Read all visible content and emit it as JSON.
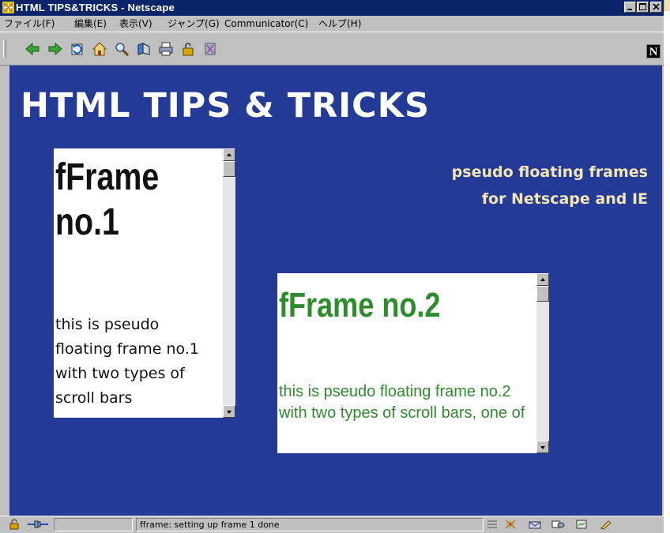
{
  "window": {
    "title": "HTML  TIPS&TRICKS - Netscape",
    "controls": [
      "minimize",
      "maximize",
      "close"
    ]
  },
  "menu": [
    {
      "label": "ファイル(F)"
    },
    {
      "label": "編集(E)"
    },
    {
      "label": "表示(V)"
    },
    {
      "label": "ジャンプ(G)"
    },
    {
      "label": "Communicator(C)"
    },
    {
      "label": "ヘルプ(H)"
    }
  ],
  "toolbar": {
    "buttons": [
      "back-icon",
      "forward-icon",
      "reload-icon",
      "home-icon",
      "search-icon",
      "netscape-guide-icon",
      "print-icon",
      "security-icon",
      "stop-icon"
    ],
    "logo": "N"
  },
  "page": {
    "title": "HTML TIPS & TRICKS",
    "subtitle_line1": "pseudo floating frames",
    "subtitle_line2": "for Netscape and IE",
    "colors": {
      "background": "#233a96",
      "subtitle": "#f2e6b5",
      "frame2_text": "#2e8b2e"
    }
  },
  "frames": [
    {
      "heading_line1": "fFrame",
      "heading_line2": "no.1",
      "body": "this is pseudo floating frame no.1 with two types of scroll bars"
    },
    {
      "heading": "fFrame no.2",
      "body": "this is pseudo floating frame no.2 with two types of scroll bars, one of"
    }
  ],
  "status": {
    "text": "fframe: setting up frame 1 done",
    "component_icons": [
      "security-icon",
      "mail-icon",
      "newsgroup-icon",
      "composer-icon",
      "address-book-icon"
    ]
  }
}
